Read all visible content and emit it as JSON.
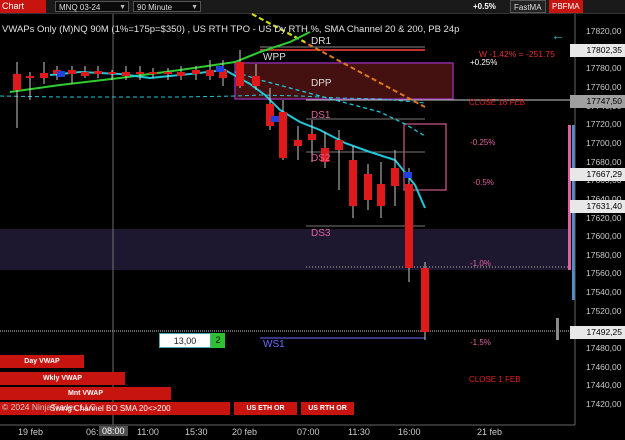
{
  "toolbar": {
    "chart_tab": "Chart",
    "symbol": "MNQ 03-24",
    "interval": "90 Minute",
    "fastma": "FastMA",
    "pbfma": "PBFMA",
    "top_pct": "+0.5%"
  },
  "title": "VWAPs Only (M)NQ 90M  (1%=175p=$350) , US RTH TPO - US Dy RTH %, SMA Channel 20 & 200, PB 24p",
  "w_stat": "W -1.42% = -251.75",
  "levels": {
    "dr1": "DR1",
    "wpp": "WPP",
    "dpp": "DPP",
    "ds1": "DS1",
    "ds2": "DS2",
    "ds3": "DS3",
    "ws1": "WS1",
    "close16": "CLOSE 16 FEB",
    "close1": "CLOSE 1 FEB",
    "p025": "+0.25%",
    "m025": "-0.25%",
    "m05": "-0.5%",
    "m10": "-1.0%",
    "m15": "-1.5%"
  },
  "price_axis": [
    "17820,00",
    "17800,00",
    "17780,00",
    "17760,00",
    "17740,00",
    "17720,00",
    "17700,00",
    "17680,00",
    "17660,00",
    "17640,00",
    "17620,00",
    "17600,00",
    "17580,00",
    "17560,00",
    "17540,00",
    "17520,00",
    "17500,00",
    "17480,00",
    "17460,00",
    "17440,00",
    "17420,00"
  ],
  "price_tags": {
    "tag1": {
      "text": "17802,35",
      "color": "#e8e8e8"
    },
    "tag2": {
      "text": "17747,50",
      "color": "#a0a0a0"
    },
    "tag3": {
      "text": "17667,29",
      "color": "#e8e8e8"
    },
    "tag4": {
      "text": "17631,40",
      "color": "#e8e8e8"
    },
    "tag5": {
      "text": "17492,25",
      "color": "#e8e8e8"
    }
  },
  "time_axis": [
    "19 feb",
    "06:00",
    "08:00",
    "11:00",
    "15:30",
    "20 feb",
    "07:00",
    "11:30",
    "16:00",
    "21 feb"
  ],
  "vwap_buttons": {
    "day": "Day VWAP",
    "wkly": "Wkly VWAP",
    "mnt": "Mnt VWAP"
  },
  "tpo_buttons": [
    "US ETH OR",
    "US RTH OR"
  ],
  "info_value": "13,00",
  "info_badge": "2",
  "copyright": "© 2024 NinjaTrader, LLC",
  "swing": "Swing Channel BO SMA 20<>200",
  "colors": {
    "bull": "#e01a1a",
    "bear": "#e01a1a",
    "sma20": "#20c8d8",
    "sma200": "#2ecc2e",
    "accent": "#c8140e"
  }
}
